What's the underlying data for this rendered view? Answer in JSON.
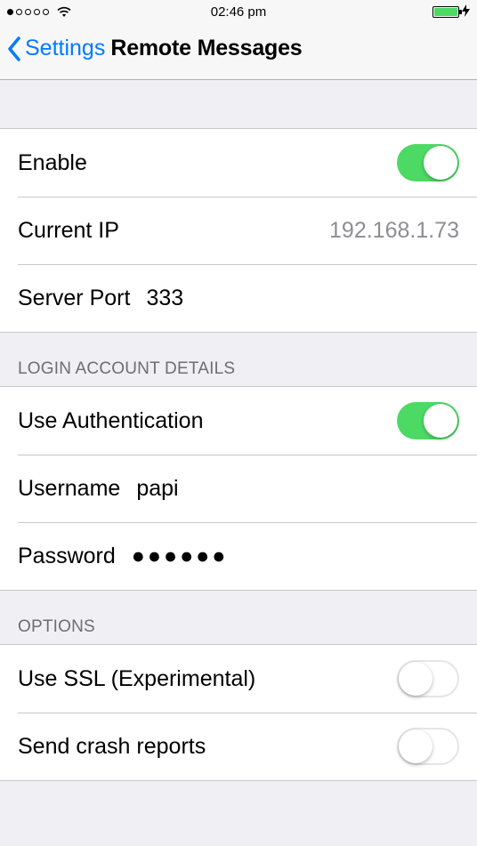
{
  "status": {
    "time": "02:46 pm"
  },
  "nav": {
    "back": "Settings",
    "title": "Remote Messages"
  },
  "section_server": {
    "enable": {
      "label": "Enable",
      "on": true
    },
    "current_ip": {
      "label": "Current IP",
      "value": "192.168.1.73"
    },
    "server_port": {
      "label": "Server Port",
      "value": "333"
    }
  },
  "section_login": {
    "header": "LOGIN ACCOUNT DETAILS",
    "use_auth": {
      "label": "Use Authentication",
      "on": true
    },
    "username": {
      "label": "Username",
      "value": "papi"
    },
    "password": {
      "label": "Password",
      "value": "●●●●●●"
    }
  },
  "section_options": {
    "header": "OPTIONS",
    "use_ssl": {
      "label": "Use SSL (Experimental)",
      "on": false
    },
    "crash_reports": {
      "label": "Send crash reports",
      "on": false
    }
  }
}
